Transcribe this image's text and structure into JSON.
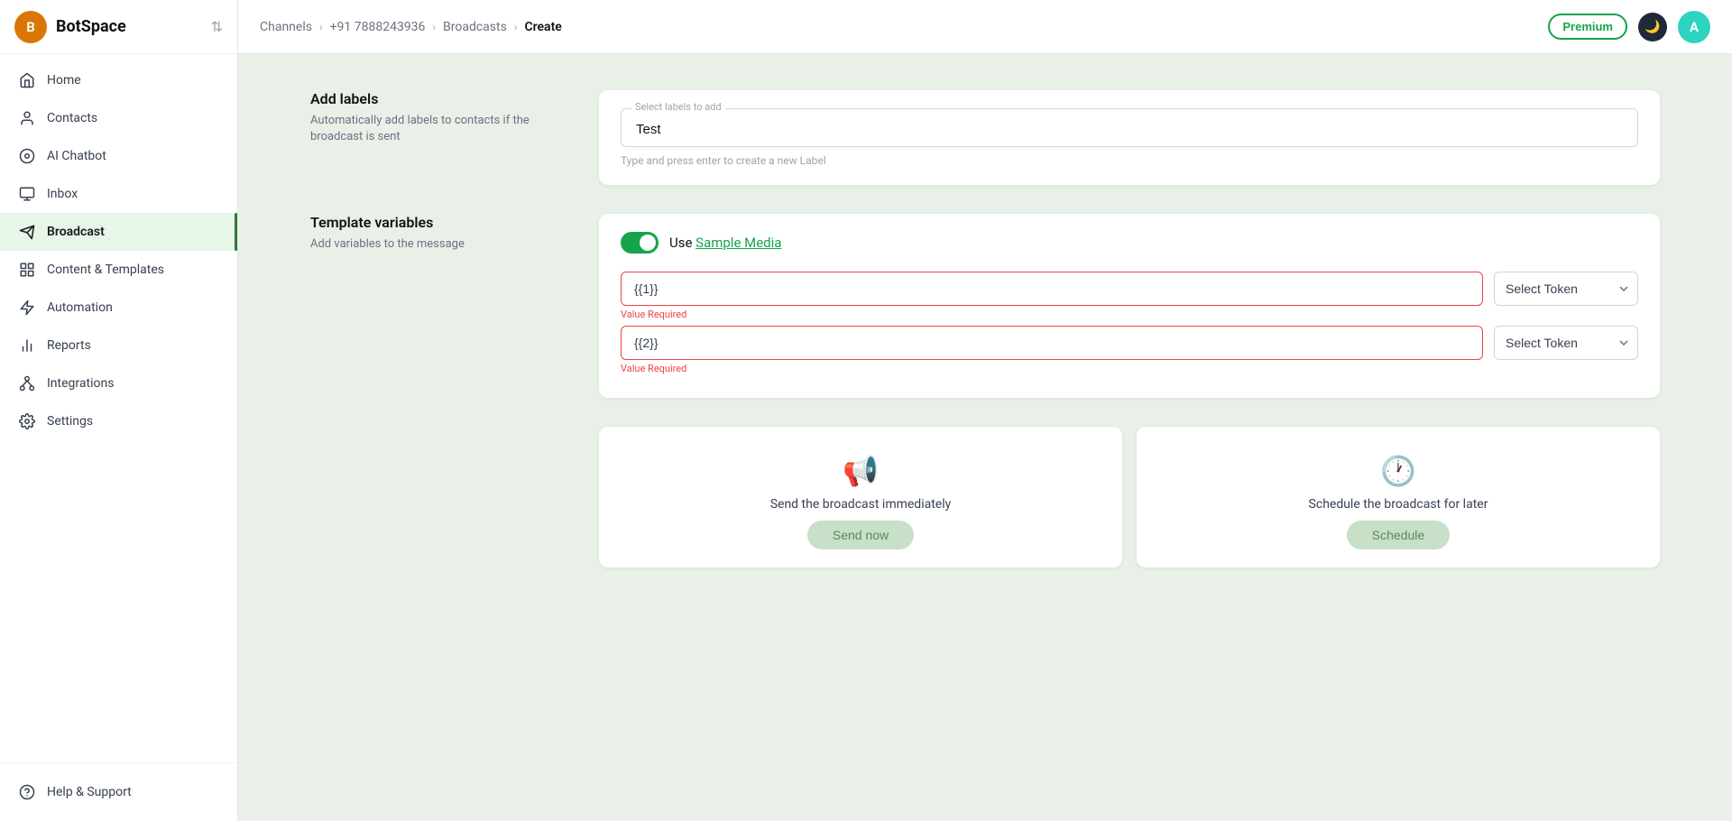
{
  "brand": "BotSpace",
  "brand_initial": "B",
  "user_initial": "A",
  "breadcrumb": {
    "channels": "Channels",
    "sep1": ">",
    "phone": "+91 7888243936",
    "sep2": ">",
    "broadcasts": "Broadcasts",
    "sep3": ">",
    "current": "Create"
  },
  "premium_label": "Premium",
  "nav": [
    {
      "id": "home",
      "label": "Home",
      "icon": "home-icon"
    },
    {
      "id": "contacts",
      "label": "Contacts",
      "icon": "contacts-icon"
    },
    {
      "id": "ai-chatbot",
      "label": "AI Chatbot",
      "icon": "chatbot-icon"
    },
    {
      "id": "inbox",
      "label": "Inbox",
      "icon": "inbox-icon"
    },
    {
      "id": "broadcast",
      "label": "Broadcast",
      "icon": "broadcast-icon",
      "active": true
    },
    {
      "id": "content-templates",
      "label": "Content & Templates",
      "icon": "templates-icon"
    },
    {
      "id": "automation",
      "label": "Automation",
      "icon": "automation-icon"
    },
    {
      "id": "reports",
      "label": "Reports",
      "icon": "reports-icon"
    },
    {
      "id": "integrations",
      "label": "Integrations",
      "icon": "integrations-icon"
    },
    {
      "id": "settings",
      "label": "Settings",
      "icon": "settings-icon"
    }
  ],
  "footer_nav": [
    {
      "id": "help-support",
      "label": "Help & Support",
      "icon": "help-icon"
    }
  ],
  "sections": {
    "add_labels": {
      "title": "Add labels",
      "description": "Automatically add labels to contacts if the broadcast is sent",
      "field_label": "Select labels to add",
      "field_value": "Test",
      "hint": "Type and press enter to create a new Label"
    },
    "template_variables": {
      "title": "Template variables",
      "description": "Add variables to the message",
      "toggle_on": true,
      "use_sample_media_prefix": "Use ",
      "use_sample_media_link": "Sample Media",
      "variables": [
        {
          "placeholder": "{{1}}",
          "error": "Value Required"
        },
        {
          "placeholder": "{{2}}",
          "error": "Value Required"
        }
      ],
      "token_placeholder": "Select Token"
    },
    "broadcast_options": {
      "immediate": {
        "icon": "📢",
        "description": "Send the broadcast immediately",
        "button": "Send now"
      },
      "schedule": {
        "icon": "🕐",
        "description": "Schedule the broadcast for later",
        "button": "Schedule"
      }
    }
  }
}
